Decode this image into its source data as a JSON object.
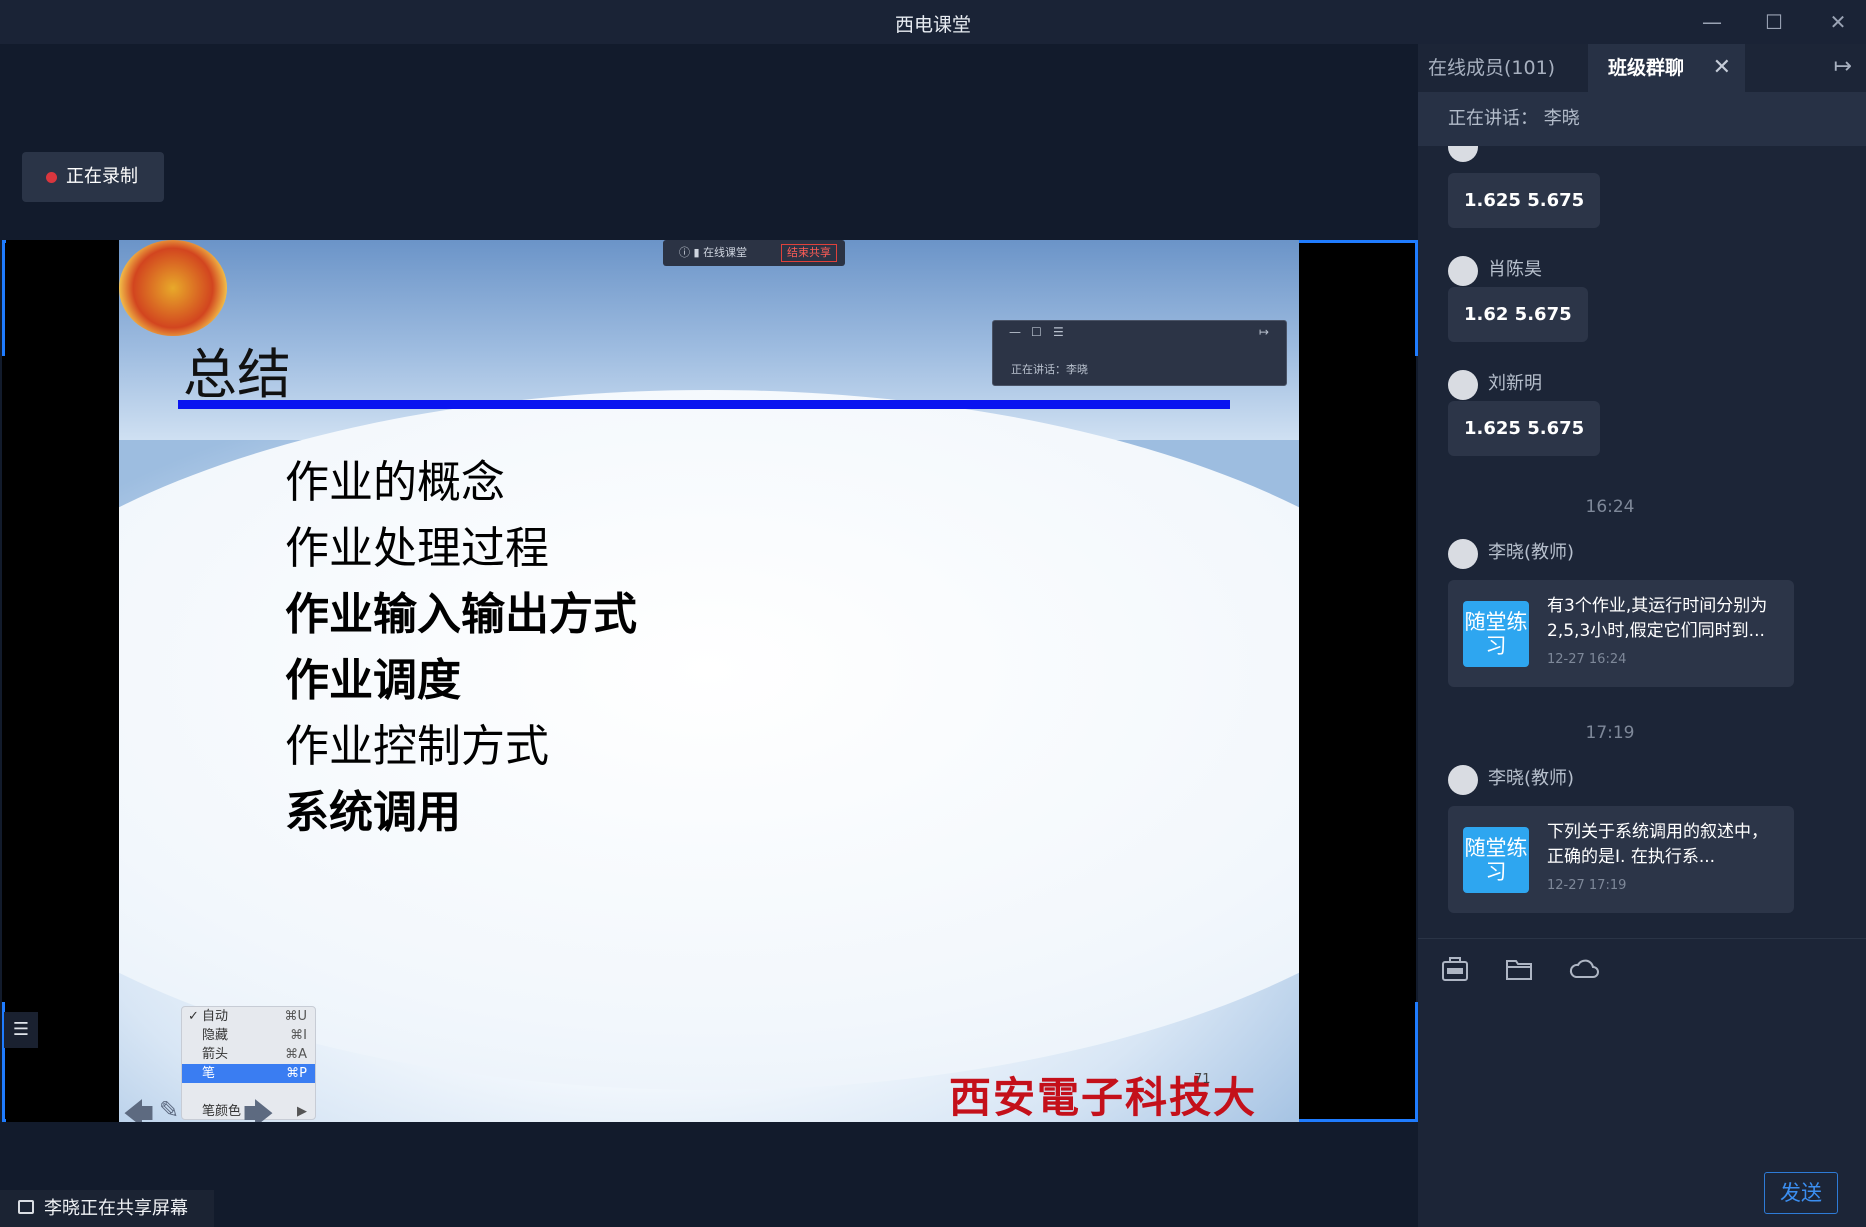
{
  "window": {
    "title": "西电课堂",
    "minimize": "—",
    "maximize": "☐",
    "close": "✕"
  },
  "stage": {
    "recording_label": "正在录制",
    "menu_icon": "☰",
    "sharing_status": "李晓正在共享屏幕",
    "share_bar": {
      "app": "在线课堂",
      "end_share": "结束共享"
    },
    "mini_window": {
      "speaker": "正在讲话：李晓"
    },
    "slide": {
      "title": "总结",
      "bullets": [
        "作业的概念",
        "作业处理过程",
        "作业输入输出方式",
        "作业调度",
        "作业控制方式",
        "系统调用"
      ],
      "university": "西安電子科技大学",
      "page": "71"
    },
    "context_menu": {
      "items": [
        {
          "label": "自动",
          "key": "⌘U",
          "checked": true
        },
        {
          "label": "隐藏",
          "key": "⌘I"
        },
        {
          "label": "箭头",
          "key": "⌘A"
        },
        {
          "label": "笔",
          "key": "⌘P",
          "selected": true
        },
        {
          "label": "笔颜色",
          "key": "▶"
        }
      ]
    }
  },
  "panel": {
    "tabs": {
      "members": "在线成员(101)",
      "group_chat": "班级群聊"
    },
    "speaking": "正在讲话：  李晓",
    "messages": [
      {
        "name": "肖陈昊",
        "text": "1.62 5.675"
      },
      {
        "name": "刘新明",
        "text": "1.625 5.675"
      }
    ],
    "first_bubble": "1.625 5.675",
    "time_1": "16:24",
    "time_2": "17:19",
    "exercises": [
      {
        "name": "李晓(教师)",
        "tag": "随堂练习",
        "text": "有3个作业,其运行时间分别为2,5,3小时,假定它们同时到...",
        "ts": "12-27 16:24"
      },
      {
        "name": "李晓(教师)",
        "tag": "随堂练习",
        "text": "下列关于系统调用的叙述中，正确的是I. 在执行系...",
        "ts": "12-27 17:19"
      }
    ],
    "send": "发送"
  }
}
